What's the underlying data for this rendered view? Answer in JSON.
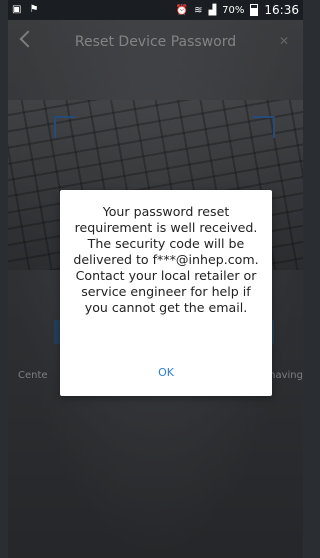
{
  "status_bar": {
    "left_icons": [
      "image-notification-icon",
      "flag-notification-icon"
    ],
    "alarm_icon": "alarm-icon",
    "wifi_icon": "wifi-icon",
    "signal_icon": "signal-icon",
    "battery_percent": "70%",
    "time": "16:36"
  },
  "header": {
    "title": "Reset Device Password",
    "back_icon": "back-icon",
    "mute_icon": "mute-icon"
  },
  "background": {
    "left_text": "Cente",
    "right_text": "having"
  },
  "dialog": {
    "message": "Your password reset requirement is well received. The security code will be delivered to f***@inhep.com. Contact your local retailer or service engineer for help if you cannot get the email.",
    "ok_label": "OK",
    "ok_color": "#2d7fd3"
  }
}
